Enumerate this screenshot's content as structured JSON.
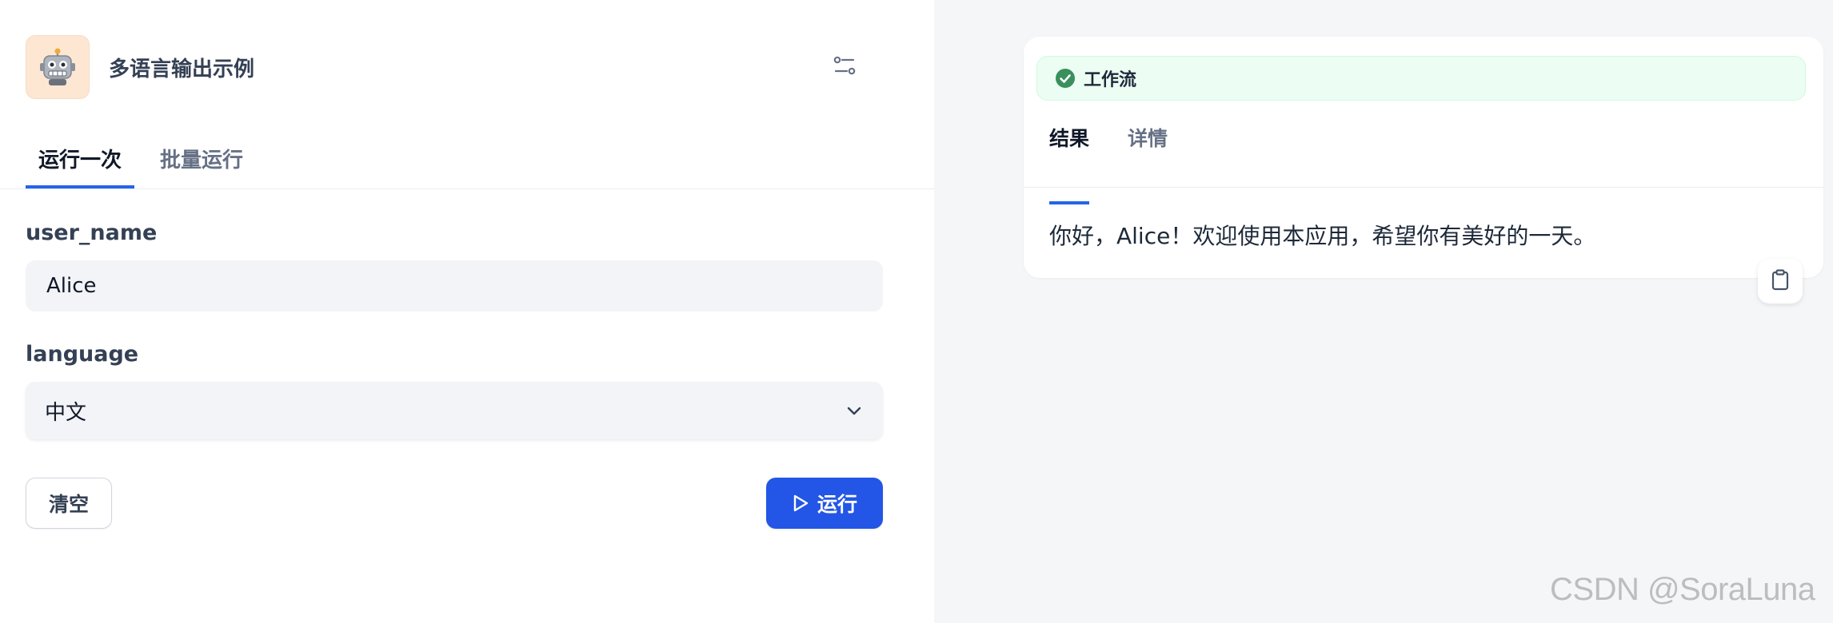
{
  "app": {
    "title": "多语言输出示例",
    "icon": "robot-icon",
    "icon_bg": "#fde7d2"
  },
  "tabs": [
    {
      "label": "运行一次",
      "active": true
    },
    {
      "label": "批量运行",
      "active": false
    }
  ],
  "form": {
    "user_name": {
      "label": "user_name",
      "value": "Alice"
    },
    "language": {
      "label": "language",
      "value": "中文"
    },
    "clear_label": "清空",
    "run_label": "运行"
  },
  "result": {
    "status": "工作流",
    "status_color": "#3a8f5c",
    "tabs": [
      {
        "label": "结果",
        "active": true
      },
      {
        "label": "详情",
        "active": false
      }
    ],
    "output": "你好，Alice！欢迎使用本应用，希望你有美好的一天。"
  },
  "watermark": "CSDN @SoraLuna",
  "colors": {
    "accent": "#2563eb",
    "run_button": "#2356e6"
  }
}
